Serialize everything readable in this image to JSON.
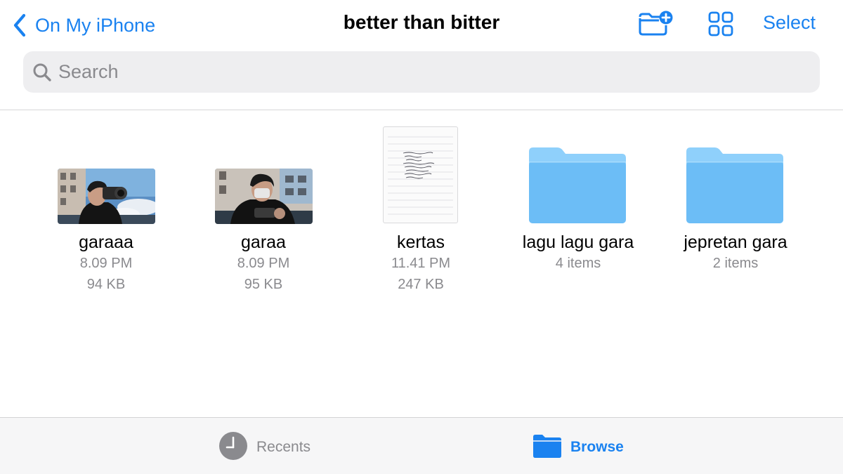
{
  "nav": {
    "back_label": "On My iPhone",
    "title": "better than bitter",
    "select_label": "Select",
    "new_folder_icon": "folder-badge-plus-icon",
    "grid_icon": "square-grid-2x2-icon"
  },
  "search": {
    "placeholder": "Search",
    "value": ""
  },
  "items": [
    {
      "name": "garaaa",
      "kind": "image",
      "time": "8.09 PM",
      "size": "94 KB"
    },
    {
      "name": "garaa",
      "kind": "image",
      "time": "8.09 PM",
      "size": "95 KB"
    },
    {
      "name": "kertas",
      "kind": "document",
      "time": "11.41 PM",
      "size": "247 KB"
    },
    {
      "name": "lagu lagu gara",
      "kind": "folder",
      "count": "4 items"
    },
    {
      "name": "jepretan gara",
      "kind": "folder",
      "count": "2 items"
    }
  ],
  "tabs": [
    {
      "label": "Recents",
      "icon": "clock-icon",
      "active": false
    },
    {
      "label": "Browse",
      "icon": "folder-fill-icon",
      "active": true
    }
  ],
  "colors": {
    "accent": "#1a82f0",
    "secondary_text": "#8a8a8e",
    "folder_light": "#8fd0fb",
    "folder_dark": "#6cbdf6",
    "search_bg": "#eeeef0"
  }
}
